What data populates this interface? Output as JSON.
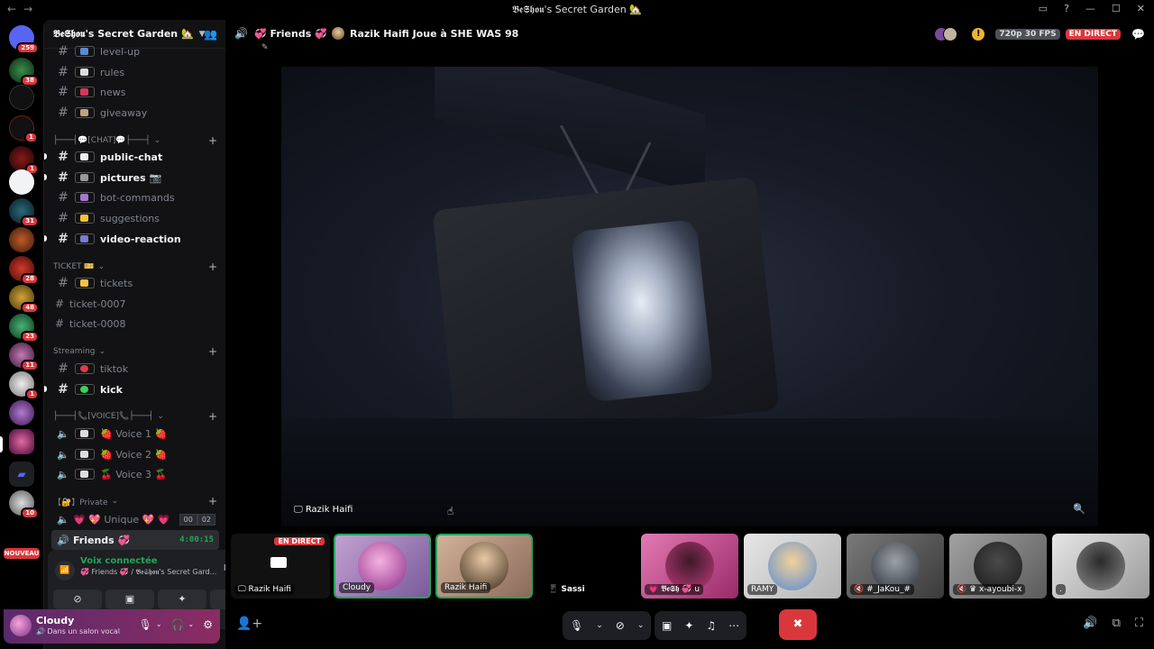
{
  "window": {
    "title": "𝕭𝖊𝕾𝖍𝖔𝖚's Secret Garden 🏡"
  },
  "servers": [
    {
      "badge": "259"
    },
    {
      "badge": "38"
    },
    {
      "badge": ""
    },
    {
      "badge": "1"
    },
    {
      "badge": "1"
    },
    {
      "badge": ""
    },
    {
      "badge": "31"
    },
    {
      "badge": ""
    },
    {
      "badge": "28"
    },
    {
      "badge": "48"
    },
    {
      "badge": "23"
    },
    {
      "badge": "11"
    },
    {
      "badge": "1"
    },
    {
      "badge": ""
    },
    {
      "badge": ""
    },
    {
      "badge": ""
    },
    {
      "badge": "10"
    }
  ],
  "new_badge": "NOUVEAU",
  "server_header": {
    "name": "𝕭𝖊𝕾𝖍𝖔𝖚's Secret Garden 🏡"
  },
  "channels": {
    "level_up": "level-up",
    "rules": "rules",
    "news": "news",
    "giveaway": "giveaway",
    "cat_chat": "├───┤💬[CHAT]💬├───┤",
    "public_chat": "public-chat",
    "pictures": "pictures 📷",
    "bot_commands": "bot-commands",
    "suggestions": "suggestions",
    "video_reaction": "video-reaction",
    "cat_ticket": "TICKET 🎫",
    "tickets": "tickets",
    "ticket_7": "ticket-0007",
    "ticket_8": "ticket-0008",
    "cat_streaming": "Streaming",
    "tiktok": "tiktok",
    "kick": "kick",
    "cat_voice": "├───┤📞[VOICE]📞├───┤",
    "voice1": "🍓 Voice 1 🍓",
    "voice2": "🍓 Voice 2 🍓",
    "voice3": "🍒 Voice 3 🍒",
    "cat_private": "【🔐】Private",
    "unique": "💗 💖 Unique 💖 💗",
    "unique_count_a": "00",
    "unique_count_b": "02",
    "friends": "Friends 💞",
    "friends_timer": "4:00:15"
  },
  "voice_panel": {
    "title": "Voix connectée",
    "subtitle": "💞 Friends 💞 / 𝕭𝖊𝕾𝖍𝖔𝖚's Secret Gard..."
  },
  "user_panel": {
    "name": "Cloudy",
    "status": "🔊 Dans un salon vocal"
  },
  "main_header": {
    "channel": "💞 Friends 💞",
    "activity": "Razik Haifi Joue à SHE WAS 98",
    "quality": "720p 30 FPS",
    "live": "EN DIRECT"
  },
  "stream": {
    "label": "🖵 Razik Haifi"
  },
  "tiles": [
    {
      "name": "🖵 Razik Haifi",
      "live": "EN DIRECT"
    },
    {
      "name": "Cloudy"
    },
    {
      "name": "Razik Haifi"
    },
    {
      "name": "📱 Sassi"
    },
    {
      "name": "💗 𝕭𝖊𝕾𝖍 💞 u"
    },
    {
      "name": "RAMY"
    },
    {
      "name": "🔇 #_JaKou_#"
    },
    {
      "name": "🔇 ♛ x-ayoubi-x"
    },
    {
      "name": "."
    }
  ],
  "colors": {
    "live_red": "#da373c",
    "voice_green": "#23a55a",
    "sidebar_bg": "#121214"
  }
}
